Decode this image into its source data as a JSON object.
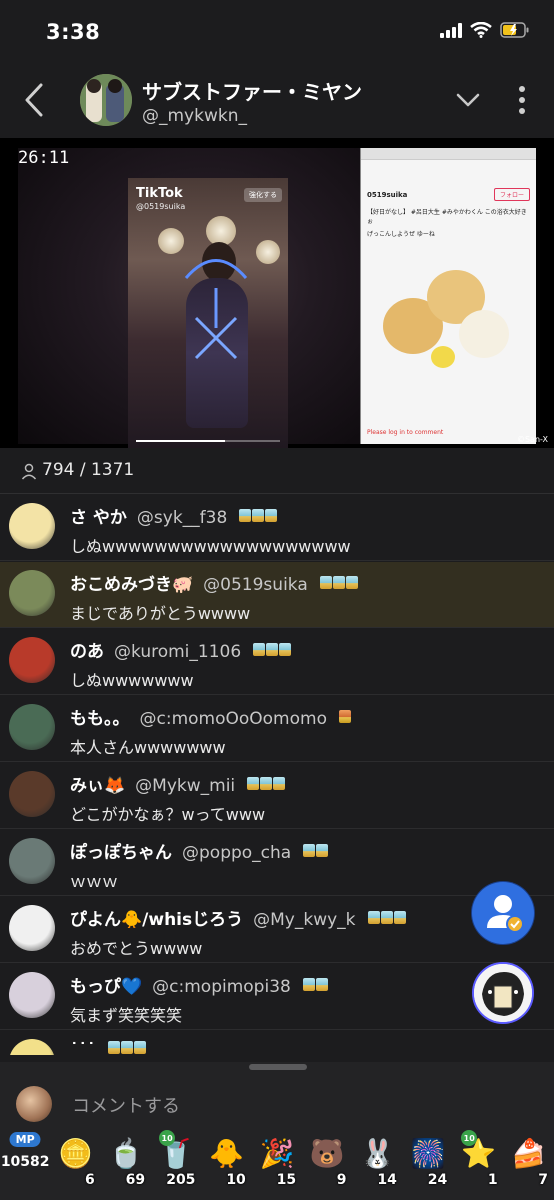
{
  "status_bar": {
    "time": "3:38"
  },
  "header": {
    "name": "サブストファー・ミヤン",
    "handle": "@_mykwkn_"
  },
  "video": {
    "timestamp": "26:11",
    "tiktok_logo": "TikTok",
    "tiktok_user": "@0519suika",
    "tiktok_follow": "強化する",
    "browser_user": "0519suika",
    "browser_follow": "フォロー",
    "browser_caption": "【好日がなし】 #呂日大生 #みやかわくん この浴衣大好きぉ",
    "browser_sound": "げっこんしようぜ ゆーね",
    "browser_footer": "Please log in to comment",
    "watermark": "©San-X",
    "progress": 0.62
  },
  "viewers": {
    "text": "794 / 1371"
  },
  "comments": [
    {
      "name": "さ やか",
      "handle": "@syk__f38",
      "text": "しぬwwwwwwwwwwwwwwwwwww",
      "tokens": 3,
      "gold": false,
      "highlight": false,
      "avatar": "#f3e3a6"
    },
    {
      "name": "おこめみづき🐖",
      "handle": "@0519suika",
      "text": "まじでありがとうwwww",
      "tokens": 3,
      "gold": false,
      "highlight": true,
      "avatar": "#7b8a5a"
    },
    {
      "name": "のあ",
      "handle": "@kuromi_1106",
      "text": "しぬwwwwwww",
      "tokens": 3,
      "gold": false,
      "highlight": false,
      "avatar": "#b83a2a"
    },
    {
      "name": "もも。。",
      "handle": "@c:momoOoOomomo",
      "text": "本人さんwwwwwww",
      "tokens": 1,
      "gold": true,
      "highlight": false,
      "avatar": "#4a6b55"
    },
    {
      "name": "みぃ🦊",
      "handle": "@Mykw_mii",
      "text": "どこがかなぁ？wってwww",
      "tokens": 3,
      "gold": false,
      "highlight": false,
      "avatar": "#5a3a2a"
    },
    {
      "name": "ぽっぽちゃん",
      "handle": "@poppo_cha",
      "text": "ｗｗｗ",
      "tokens": 2,
      "gold": false,
      "highlight": false,
      "avatar": "#6a7a76"
    },
    {
      "name": "ぴよん🐥/whisじろう",
      "handle": "@My_kwy_k",
      "text": "おめでとうwwww",
      "tokens": 3,
      "gold": false,
      "highlight": false,
      "avatar": "#f0f0f0"
    },
    {
      "name": "もっぴ💙",
      "handle": "@c:mopimopi38",
      "text": "気まず笑笑笑笑",
      "tokens": 2,
      "gold": false,
      "highlight": false,
      "avatar": "#d8d0dc"
    },
    {
      "name": "˙˙˙",
      "handle": "",
      "text": "",
      "tokens": 3,
      "gold": false,
      "highlight": false,
      "avatar": "#f2e08a"
    }
  ],
  "comment_input": {
    "placeholder": "コメントする"
  },
  "items_bar": {
    "mp": {
      "label": "MP",
      "count": "10582"
    },
    "items": [
      {
        "icon": "coin-icon",
        "glyph": "🪙",
        "count": "6",
        "ten": false
      },
      {
        "icon": "leaf-glass-icon",
        "glyph": "🍵",
        "count": "69",
        "ten": false
      },
      {
        "icon": "drink-icon",
        "glyph": "🥤",
        "count": "205",
        "ten": true
      },
      {
        "icon": "chick-icon",
        "glyph": "🐥",
        "count": "10",
        "ten": false
      },
      {
        "icon": "party-popper-icon",
        "glyph": "🎉",
        "count": "15",
        "ten": false
      },
      {
        "icon": "bear-icon",
        "glyph": "🐻",
        "count": "9",
        "ten": false
      },
      {
        "icon": "rabbit-icon",
        "glyph": "🐰",
        "count": "14",
        "ten": false
      },
      {
        "icon": "fireworks-icon",
        "glyph": "🎆",
        "count": "24",
        "ten": false
      },
      {
        "icon": "star-icon",
        "glyph": "⭐",
        "count": "1",
        "ten": true
      },
      {
        "icon": "cake-icon",
        "glyph": "🍰",
        "count": "7",
        "ten": false
      }
    ]
  }
}
